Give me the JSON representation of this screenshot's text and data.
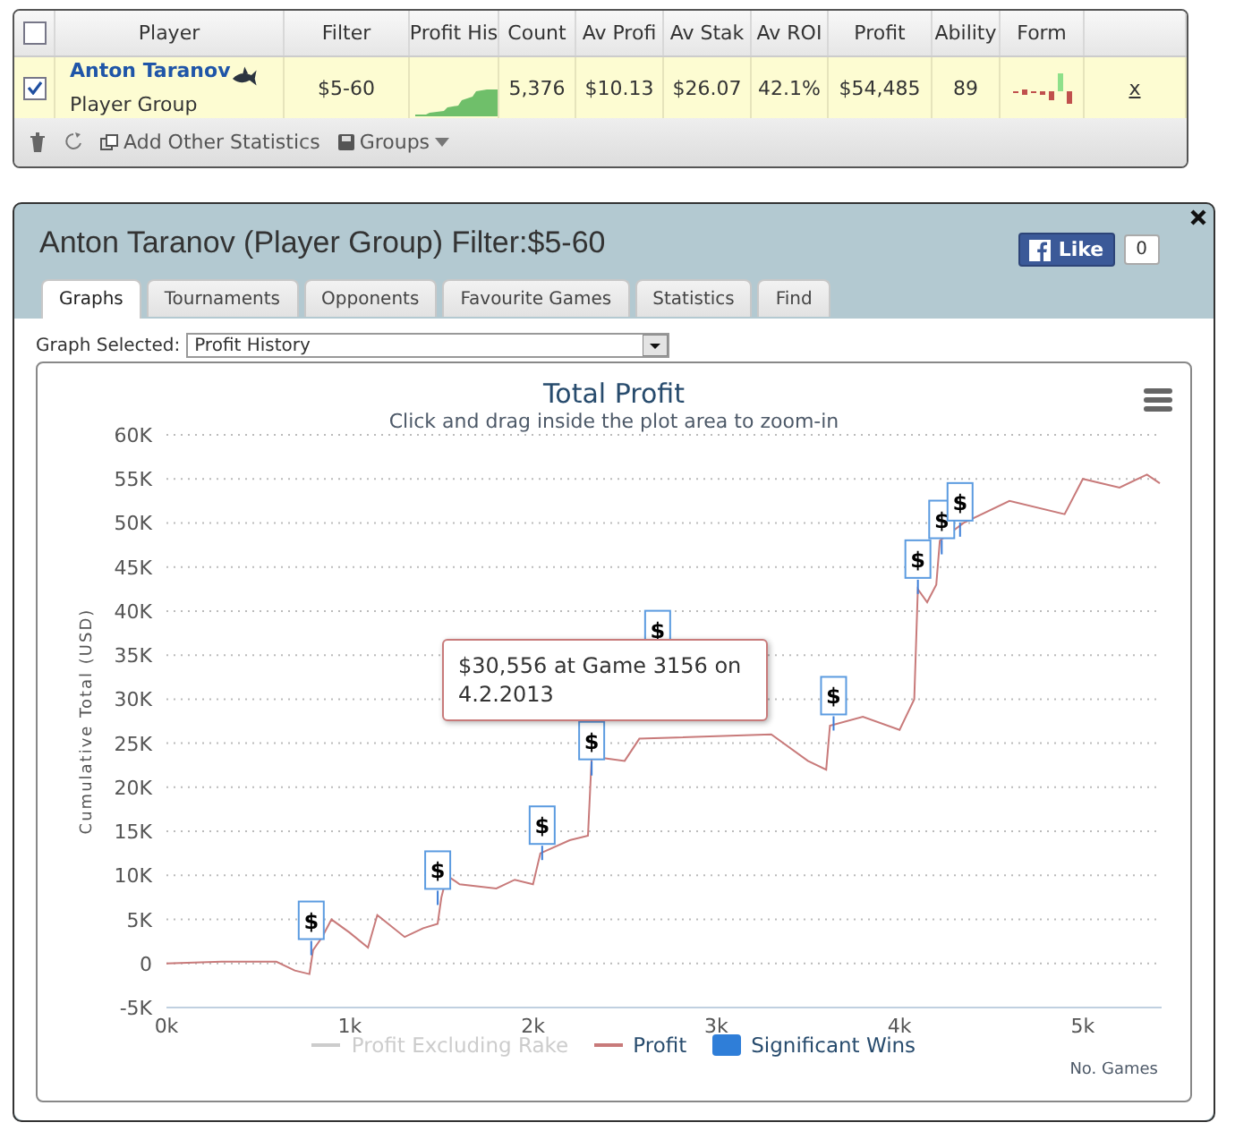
{
  "stats_table": {
    "select_all_checked": false,
    "columns": [
      "Player",
      "Filter",
      "Profit His",
      "Count",
      "Av Profi",
      "Av Stak",
      "Av ROI",
      "Profit",
      "Ability",
      "Form"
    ],
    "rows": [
      {
        "checked": true,
        "player": "Anton Taranov",
        "group": "Player Group",
        "filter": "$5-60",
        "count": "5,376",
        "av_profit": "$10.13",
        "av_stake": "$26.07",
        "av_roi": "42.1%",
        "profit": "$54,485",
        "ability": "89",
        "remove": "x"
      }
    ],
    "toolbar": {
      "add_stats": "Add Other Statistics",
      "groups": "Groups"
    }
  },
  "window": {
    "title": "Anton Taranov (Player Group) Filter:$5-60",
    "like": "Like",
    "like_count": "0",
    "tabs": [
      {
        "label": "Graphs",
        "selected": true
      },
      {
        "label": "Tournaments",
        "selected": false
      },
      {
        "label": "Opponents",
        "selected": false
      },
      {
        "label": "Favourite Games",
        "selected": false
      },
      {
        "label": "Statistics",
        "selected": false
      },
      {
        "label": "Find",
        "selected": false
      }
    ]
  },
  "graph_select": {
    "label": "Graph Selected:",
    "value": "Profit History"
  },
  "chart": {
    "subtitle": "Click and drag inside the plot area to zoom-in",
    "tooltip": "$30,556 at Game 3156 on 4.2.2013",
    "chart_data": {
      "type": "line",
      "title": "Total Profit",
      "xlabel": "No. Games",
      "ylabel": "Cumulative Total (USD)",
      "grid": true,
      "xlim": [
        0,
        5420
      ],
      "ylim": [
        -5000,
        60000
      ],
      "xticks": [
        {
          "value": 0,
          "label": "0k"
        },
        {
          "value": 1000,
          "label": "1k"
        },
        {
          "value": 2000,
          "label": "2k"
        },
        {
          "value": 3000,
          "label": "3k"
        },
        {
          "value": 4000,
          "label": "4k"
        },
        {
          "value": 5000,
          "label": "5k"
        }
      ],
      "yticks": [
        {
          "value": 60000,
          "label": "60K"
        },
        {
          "value": 55000,
          "label": "55K"
        },
        {
          "value": 50000,
          "label": "50K"
        },
        {
          "value": 45000,
          "label": "45K"
        },
        {
          "value": 40000,
          "label": "40K"
        },
        {
          "value": 35000,
          "label": "35K"
        },
        {
          "value": 30000,
          "label": "30K"
        },
        {
          "value": 25000,
          "label": "25K"
        },
        {
          "value": 20000,
          "label": "20K"
        },
        {
          "value": 15000,
          "label": "15K"
        },
        {
          "value": 10000,
          "label": "10K"
        },
        {
          "value": 5000,
          "label": "5K"
        },
        {
          "value": 0,
          "label": "0"
        },
        {
          "value": -5000,
          "label": "-5K"
        }
      ],
      "x": [
        0,
        300,
        600,
        700,
        780,
        800,
        850,
        900,
        1000,
        1100,
        1150,
        1300,
        1400,
        1480,
        1500,
        1530,
        1600,
        1800,
        1900,
        2000,
        2040,
        2200,
        2300,
        2320,
        2500,
        2580,
        3300,
        3500,
        3600,
        3620,
        3800,
        4000,
        4080,
        4100,
        4150,
        4200,
        4220,
        4350,
        4600,
        4900,
        5000,
        5200,
        5350,
        5420
      ],
      "series": [
        {
          "name": "Profit",
          "color": "#c87a7a",
          "values": [
            0,
            200,
            200,
            -800,
            -1200,
            1500,
            3000,
            5000,
            3500,
            1800,
            5500,
            3000,
            4000,
            4500,
            7500,
            10000,
            9000,
            8500,
            9500,
            9000,
            12500,
            14000,
            14500,
            23500,
            23000,
            25500,
            26000,
            23000,
            22000,
            27000,
            28000,
            26500,
            30000,
            42500,
            41000,
            43000,
            48000,
            50000,
            52500,
            51000,
            55000,
            54000,
            55500,
            54500
          ]
        }
      ]
    },
    "flags": [
      {
        "label": "$"
      },
      {
        "label": "$"
      },
      {
        "label": "$"
      },
      {
        "label": "$"
      },
      {
        "label": "$"
      },
      {
        "label": "$"
      },
      {
        "label": "$"
      },
      {
        "label": "$"
      },
      {
        "label": "$"
      }
    ],
    "legend": [
      {
        "label": "Profit Excluding Rake",
        "kind": "line",
        "visible": false
      },
      {
        "kind": "series",
        "visible": true
      },
      {
        "label": "Significant Wins",
        "kind": "flag",
        "visible": true
      }
    ]
  }
}
